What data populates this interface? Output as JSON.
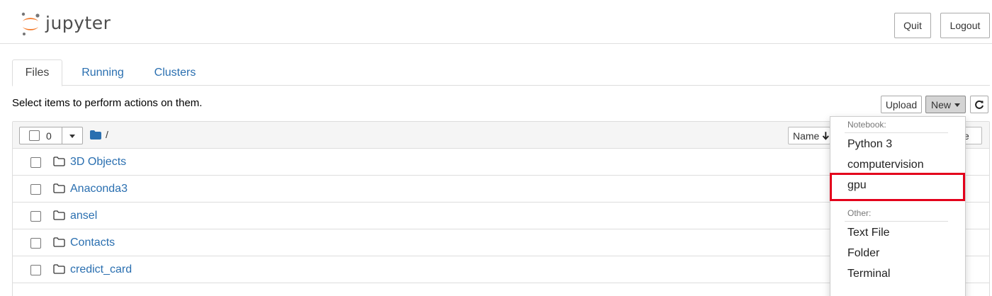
{
  "header": {
    "logo_text": "jupyter",
    "quit_label": "Quit",
    "logout_label": "Logout"
  },
  "tabs": [
    {
      "label": "Files",
      "active": true
    },
    {
      "label": "Running",
      "active": false
    },
    {
      "label": "Clusters",
      "active": false
    }
  ],
  "toolbar": {
    "instructions": "Select items to perform actions on them.",
    "upload_label": "Upload",
    "new_label": "New",
    "refresh_icon": "refresh-icon"
  },
  "list_header": {
    "selected_count": "0",
    "breadcrumb": "/",
    "name_sort_label": "Name",
    "size_sort_label": "ze"
  },
  "files": [
    {
      "name": "3D Objects",
      "type": "folder"
    },
    {
      "name": "Anaconda3",
      "type": "folder"
    },
    {
      "name": "ansel",
      "type": "folder"
    },
    {
      "name": "Contacts",
      "type": "folder"
    },
    {
      "name": "credict_card",
      "type": "folder"
    }
  ],
  "new_menu": {
    "notebook_header": "Notebook:",
    "notebook_items": [
      "Python 3",
      "computervision",
      "gpu"
    ],
    "other_header": "Other:",
    "other_items": [
      "Text File",
      "Folder",
      "Terminal"
    ],
    "highlighted_item": "gpu"
  },
  "colors": {
    "link_blue": "#2a6fb0",
    "jupyter_orange": "#f37726",
    "highlight_red": "#e3001b"
  }
}
